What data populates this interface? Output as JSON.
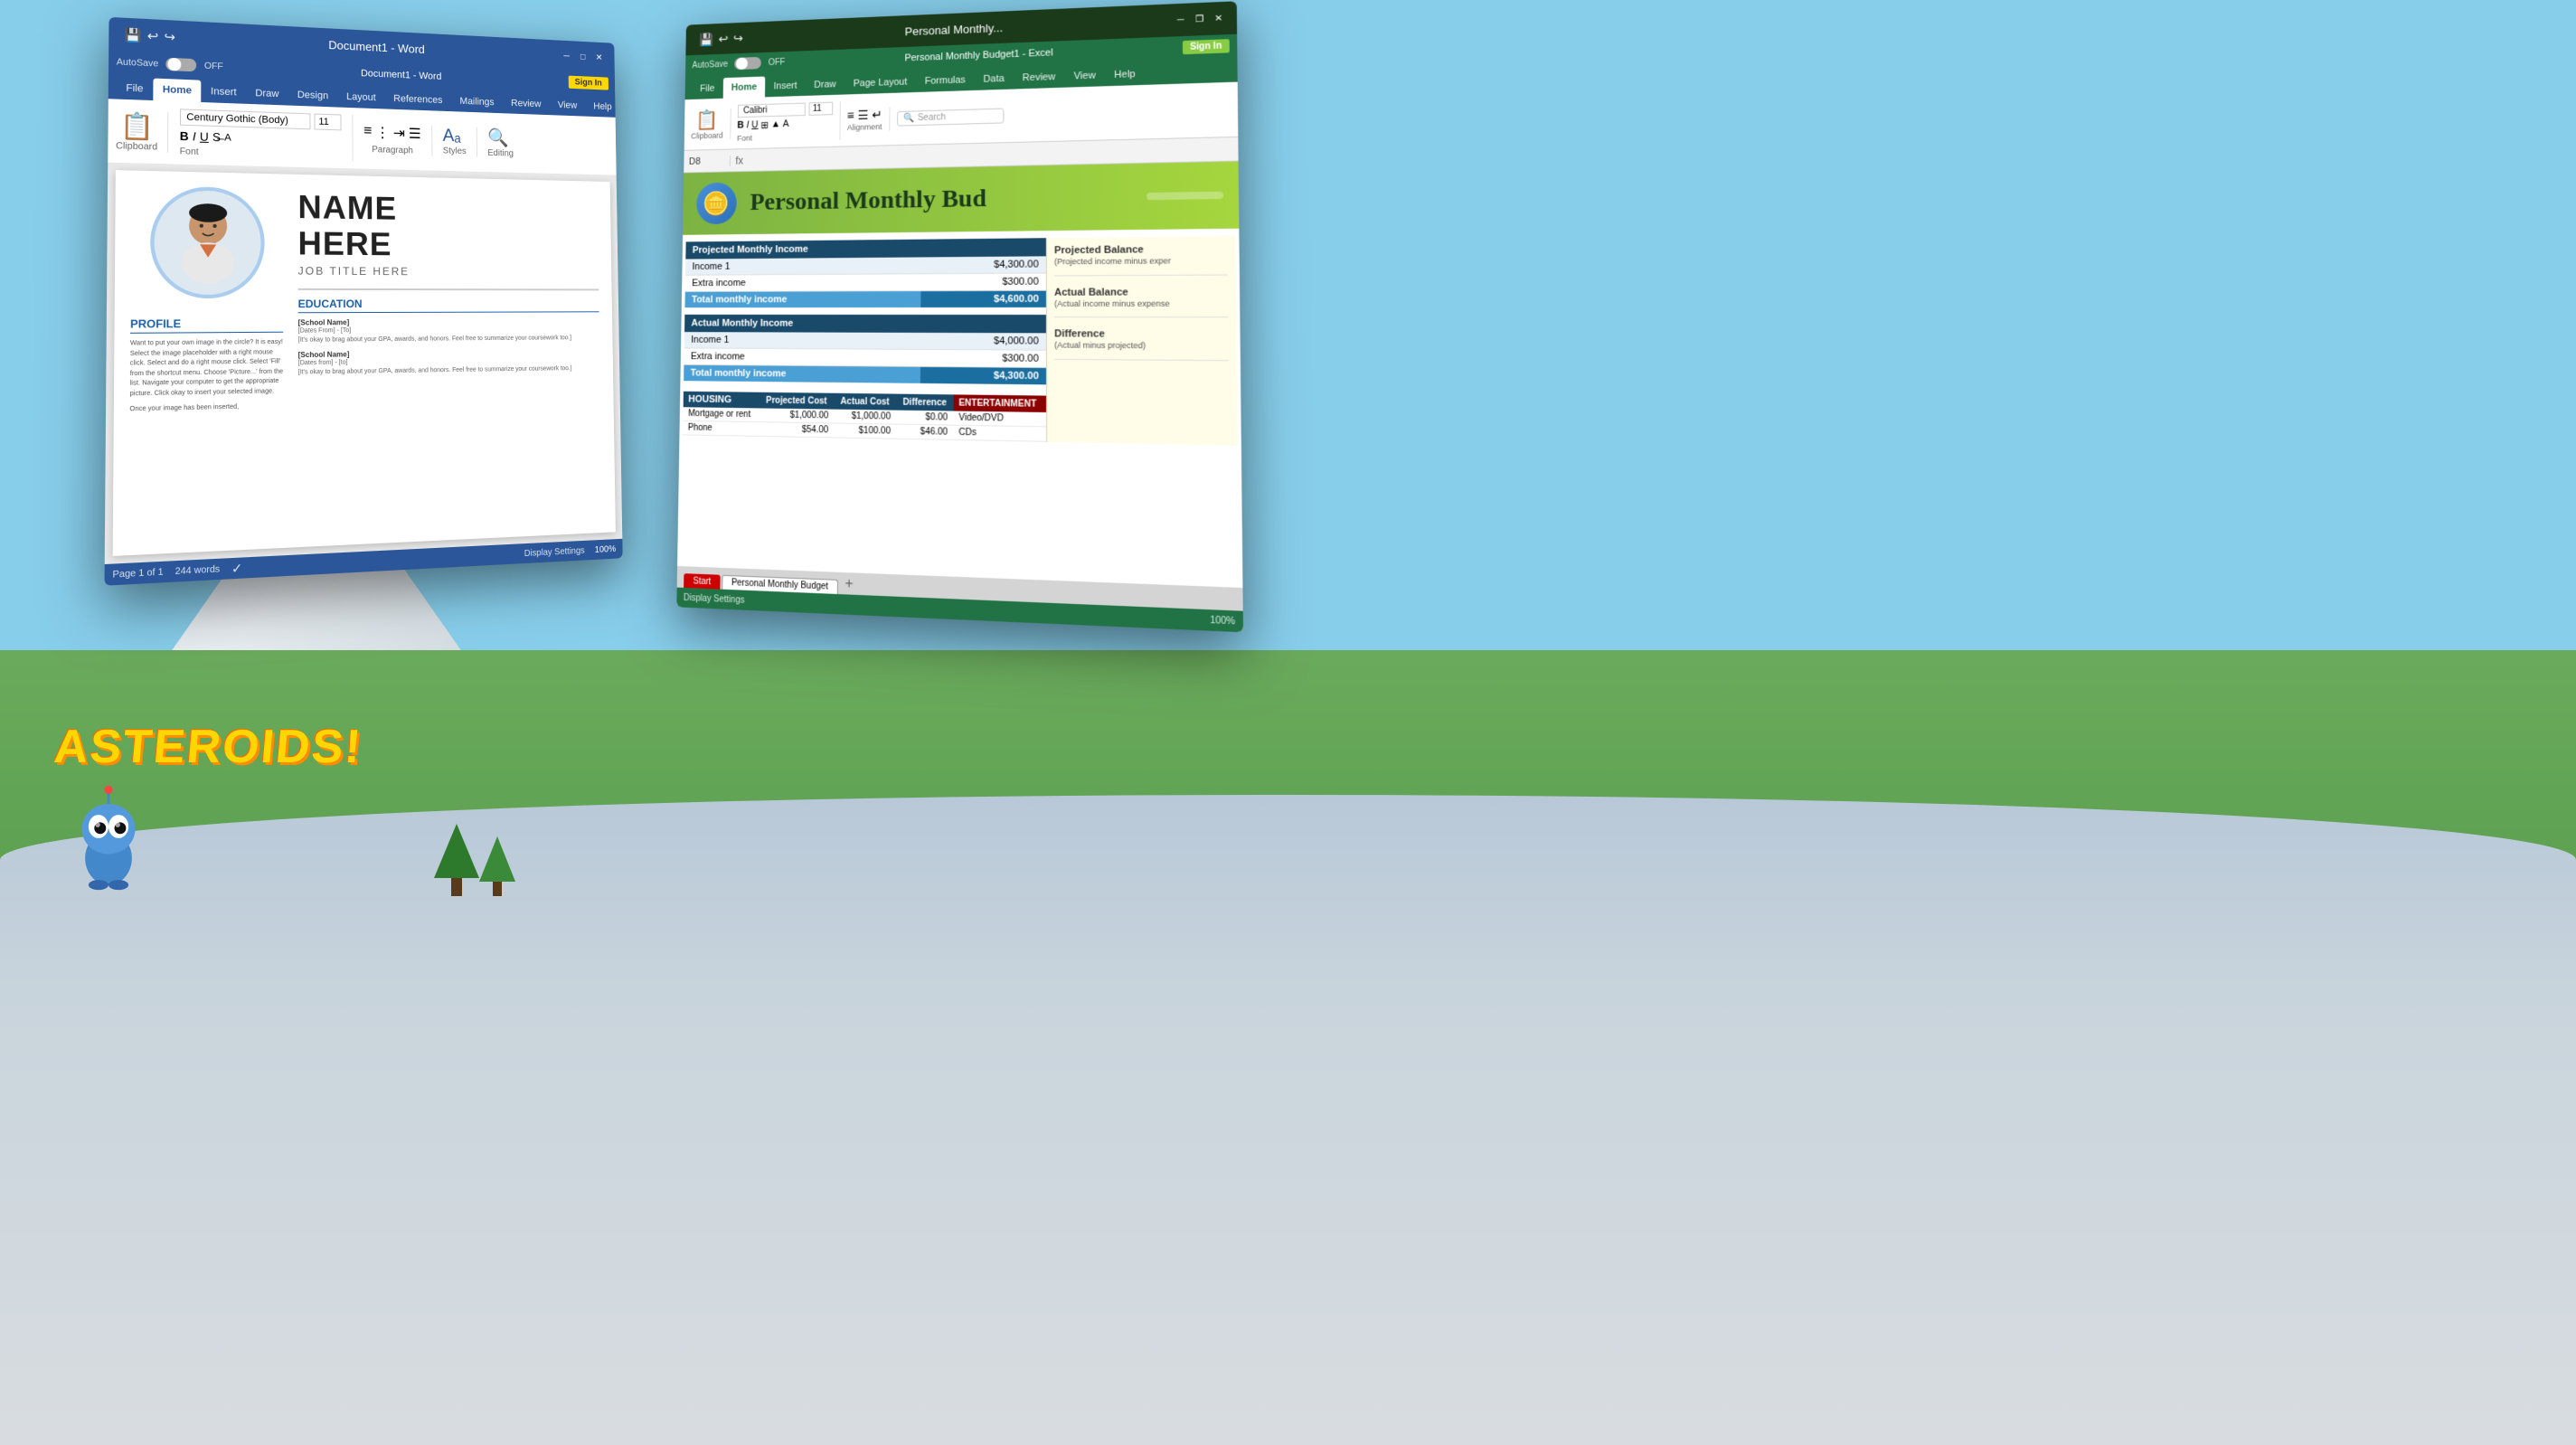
{
  "scene": {
    "background": {
      "sky_color": "#87CEEB",
      "grass_color": "#5a9e6e",
      "floor_color": "#c8d4dc"
    }
  },
  "asteroids": {
    "logo_text": "ASTEROIDS!"
  },
  "word_window": {
    "title": "Document1 - Word",
    "autosave_label": "AutoSave",
    "autosave_state": "OFF",
    "tabs": [
      "File",
      "Home",
      "Insert",
      "Draw",
      "Design",
      "Layout",
      "References",
      "Mailings",
      "Review",
      "View",
      "Help"
    ],
    "active_tab": "Home",
    "font_name": "Century Gothic (Body)",
    "font_size": "11",
    "sign_in_label": "Sign In",
    "document": {
      "name_placeholder": "NAME\nHERE",
      "job_title": "JOB TITLE HERE",
      "sections": {
        "profile_title": "PROFILE",
        "profile_text": "Want to put your own image in the circle? It is easy! Select the image placeholder with a right mouse click. Select and do a right mouse click. Select 'Fill' from the shortcut menu. Choose 'Picture...' from the list. Navigate your computer to get the appropriate picture. Click okay to insert your selected image.",
        "profile_text2": "Once your image has been inserted,",
        "education_title": "EDUCATION",
        "school1_name": "[School Name]",
        "school1_dates": "[Dates From] - [To]",
        "school1_detail": "[It's okay to brag about your GPA, awards, and honors. Feel free to summarize your coursework too.]",
        "school2_name": "[School Name]",
        "school2_dates": "[Dates from] - [to]",
        "school2_detail": "[It's okay to brag about your GPA, awards, and honors. Feel free to summarize your coursework too.]"
      }
    },
    "status_bar": {
      "page_info": "Page 1 of 1",
      "word_count": "244 words",
      "display_settings": "Display Settings"
    }
  },
  "excel_window": {
    "title": "Personal Monthly...",
    "full_title": "Personal Monthly Budget1 - Excel",
    "autosave_label": "AutoSave",
    "autosave_state": "OFF",
    "sign_in_label": "Sign In",
    "tabs": [
      "File",
      "Home",
      "Insert",
      "Draw",
      "Page Layout",
      "Formulas",
      "Data",
      "Review",
      "View",
      "Help"
    ],
    "active_tab": "Home",
    "cell_ref": "D8",
    "formula_bar_content": "",
    "search_placeholder": "Search",
    "budget": {
      "title": "Personal Monthly Bud",
      "sections": {
        "projected_income": {
          "header": "Projected Monthly Income",
          "rows": [
            {
              "label": "Income 1",
              "amount": "$4,300.00"
            },
            {
              "label": "Extra income",
              "amount": "$300.00"
            },
            {
              "label": "Total monthly income",
              "amount": "$4,600.00"
            }
          ]
        },
        "actual_income": {
          "header": "Actual Monthly Income",
          "rows": [
            {
              "label": "Income 1",
              "amount": "$4,000.00"
            },
            {
              "label": "Extra income",
              "amount": "$300.00"
            },
            {
              "label": "Total monthly income",
              "amount": "$4,300.00"
            }
          ]
        },
        "housing": {
          "header": "HOUSING",
          "columns": [
            "Projected Cost",
            "Actual Cost",
            "Difference"
          ],
          "rows": [
            {
              "label": "Mortgage or rent",
              "projected": "$1,000.00",
              "actual": "$1,000.00",
              "difference": "$0.00"
            },
            {
              "label": "Phone",
              "projected": "$54.00",
              "actual": "$100.00",
              "difference": "$46.00"
            }
          ]
        }
      },
      "right_panel": {
        "projected_balance_label": "Projected Balance",
        "projected_balance_desc": "(Projected income minus exper",
        "actual_balance_label": "Actual Balance",
        "actual_balance_desc": "(Actual income minus expense",
        "difference_label": "Difference",
        "difference_desc": "(Actual minus projected)"
      },
      "entertainment": {
        "header": "ENTERTAINMENT",
        "rows": [
          {
            "label": "Video/DVD"
          },
          {
            "label": "CDs"
          }
        ]
      }
    },
    "sheet_tabs": [
      "Start",
      "Personal Monthly Budget"
    ],
    "status_bar": {
      "display_settings": "Display Settings",
      "zoom": "100%"
    }
  }
}
